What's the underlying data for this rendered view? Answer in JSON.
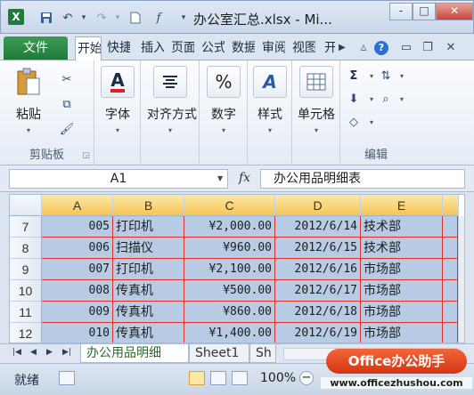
{
  "window": {
    "title": "办公室汇总.xlsx - Mi...",
    "minimize": "-",
    "restore": "□",
    "close": "✕"
  },
  "qat": {
    "save_icon": "save-icon",
    "undo_icon": "undo-icon",
    "redo_icon": "redo-icon"
  },
  "tabs": {
    "file": "文件",
    "items": [
      "开始",
      "快捷",
      "插入",
      "页面",
      "公式",
      "数据",
      "审阅",
      "视图",
      "开发"
    ]
  },
  "ribbon": {
    "clipboard": {
      "paste": "粘贴",
      "group": "剪贴板"
    },
    "font": {
      "label": "字体"
    },
    "alignment": {
      "label": "对齐方式"
    },
    "number": {
      "label": "数字",
      "symbol": "%"
    },
    "styles": {
      "label": "样式"
    },
    "cells": {
      "label": "单元格"
    },
    "editing": {
      "group": "编辑",
      "sigma": "Σ"
    }
  },
  "formula_bar": {
    "name_box": "A1",
    "fx": "fx",
    "content": "办公用品明细表"
  },
  "grid": {
    "columns": [
      "A",
      "B",
      "C",
      "D",
      "E"
    ],
    "rows": [
      {
        "num": "7",
        "a": "005",
        "b": "打印机",
        "c": "¥2,000.00",
        "d": "2012/6/14",
        "e": "技术部"
      },
      {
        "num": "8",
        "a": "006",
        "b": "扫描仪",
        "c": "¥960.00",
        "d": "2012/6/15",
        "e": "技术部"
      },
      {
        "num": "9",
        "a": "007",
        "b": "打印机",
        "c": "¥2,100.00",
        "d": "2012/6/16",
        "e": "市场部"
      },
      {
        "num": "10",
        "a": "008",
        "b": "传真机",
        "c": "¥500.00",
        "d": "2012/6/17",
        "e": "市场部"
      },
      {
        "num": "11",
        "a": "009",
        "b": "传真机",
        "c": "¥860.00",
        "d": "2012/6/18",
        "e": "市场部"
      },
      {
        "num": "12",
        "a": "010",
        "b": "传真机",
        "c": "¥1,400.00",
        "d": "2012/6/19",
        "e": "市场部"
      }
    ]
  },
  "sheets": {
    "active": "办公用品明细",
    "second": "Sheet1",
    "third": "Sh"
  },
  "status": {
    "ready": "就绪",
    "zoom": "100%"
  },
  "watermark": {
    "brand": "Office办公助手",
    "url": "www.officezhushou.com"
  }
}
